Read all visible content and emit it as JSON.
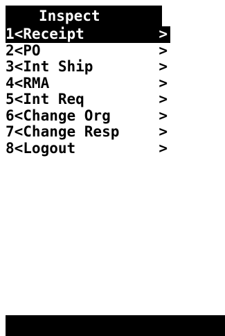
{
  "header": {
    "title": "Inspect"
  },
  "menu": {
    "items": [
      {
        "label": "1<Receipt",
        "arrow": ">"
      },
      {
        "label": "2<PO",
        "arrow": ">"
      },
      {
        "label": "3<Int Ship",
        "arrow": ">"
      },
      {
        "label": "4<RMA",
        "arrow": ">"
      },
      {
        "label": "5<Int Req",
        "arrow": ">"
      },
      {
        "label": "6<Change Org",
        "arrow": ">"
      },
      {
        "label": "7<Change Resp",
        "arrow": ">"
      },
      {
        "label": "8<Logout",
        "arrow": ">"
      }
    ],
    "selected_index": 0
  },
  "colors": {
    "background": "#ffffff",
    "foreground": "#000000",
    "highlight": "#000000"
  }
}
